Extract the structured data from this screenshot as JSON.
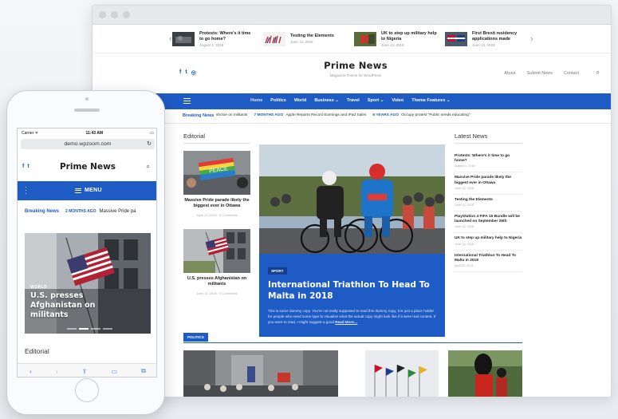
{
  "desktop": {
    "ticker": [
      {
        "title": "Protests: Where's it time to go home?",
        "date": "August 1, 2018"
      },
      {
        "title": "Testing the Elements",
        "date": "June 13, 2018"
      },
      {
        "title": "UK to step up military help to Nigeria",
        "date": "June 13, 2018"
      },
      {
        "title": "First Brexit residency applications made",
        "date": "June 13, 2018"
      }
    ],
    "brand": {
      "name": "Prime News",
      "tagline": "Magazine Theme for WordPress"
    },
    "social": [
      "f",
      "t",
      "◎"
    ],
    "topnav": [
      "About",
      "Submit News",
      "Contact"
    ],
    "menu": [
      "Home",
      "Politics",
      "World",
      "Business ⌄",
      "Travel",
      "Sport ⌄",
      "Video",
      "Theme Features ⌄"
    ],
    "breaking": {
      "label": "Breaking News",
      "items": [
        {
          "ago": "",
          "text": "shcloe on militants"
        },
        {
          "ago": "7 MONTHS AGO",
          "text": "Apple Reports Record Earnings and iPad Sales"
        },
        {
          "ago": "6 YEARS AGO",
          "text": "Occupy protest \"Public needs educating\""
        }
      ]
    },
    "editorial": {
      "heading": "Editorial",
      "cards": [
        {
          "title": "Massive Pride parade likely the biggest ever in Ottawa",
          "meta": "June 13, 2018  ·  8 Comments"
        },
        {
          "title": "U.S. presses Afghanistan on militants",
          "meta": "June 13, 2018  ·  0 Comments"
        }
      ]
    },
    "hero": {
      "badge": "SPORT",
      "title": "International Triathlon To Head To Malta in 2018",
      "excerpt": "This is some dummy copy. You're not really supposed to read this dummy copy, it is just a place holder for people who need some type to visualize what the actual copy might look like if it were real content. If you want to read, I might suggest a good",
      "read_more": "Read More…"
    },
    "latest": {
      "heading": "Latest News",
      "items": [
        {
          "title": "Protests: Where's it time to go home?",
          "date": "August 1, 2018"
        },
        {
          "title": "Massive Pride parade likely the biggest ever in Ottawa",
          "date": "June 13, 2018"
        },
        {
          "title": "Testing the Elements",
          "date": "June 13, 2018"
        },
        {
          "title": "PlayStation 4 FIFA 15 Bundle will be launched on September 25th",
          "date": "June 13, 2018"
        },
        {
          "title": "UK to step up military help to Nigeria",
          "date": "June 13, 2018"
        },
        {
          "title": "International Triathlon To Head To Malta in 2018",
          "date": "April 20, 2018"
        }
      ]
    },
    "politics_label": "POLITICS"
  },
  "mobile": {
    "status": {
      "carrier": "Carrier ᯤ",
      "time": "11:43 AM",
      "battery": "▭"
    },
    "url": "demo.wpzoom.com",
    "brand": "Prime News",
    "menu_label": "MENU",
    "breaking": {
      "label": "Breaking News",
      "ago": "2 MONTHS AGO",
      "text": "Massive Pride pa"
    },
    "hero": {
      "category": "WORLD",
      "title": "U.S. presses Afghanistan on militants"
    },
    "editorial": "Editorial"
  },
  "colors": {
    "accent": "#1f5bc4"
  }
}
